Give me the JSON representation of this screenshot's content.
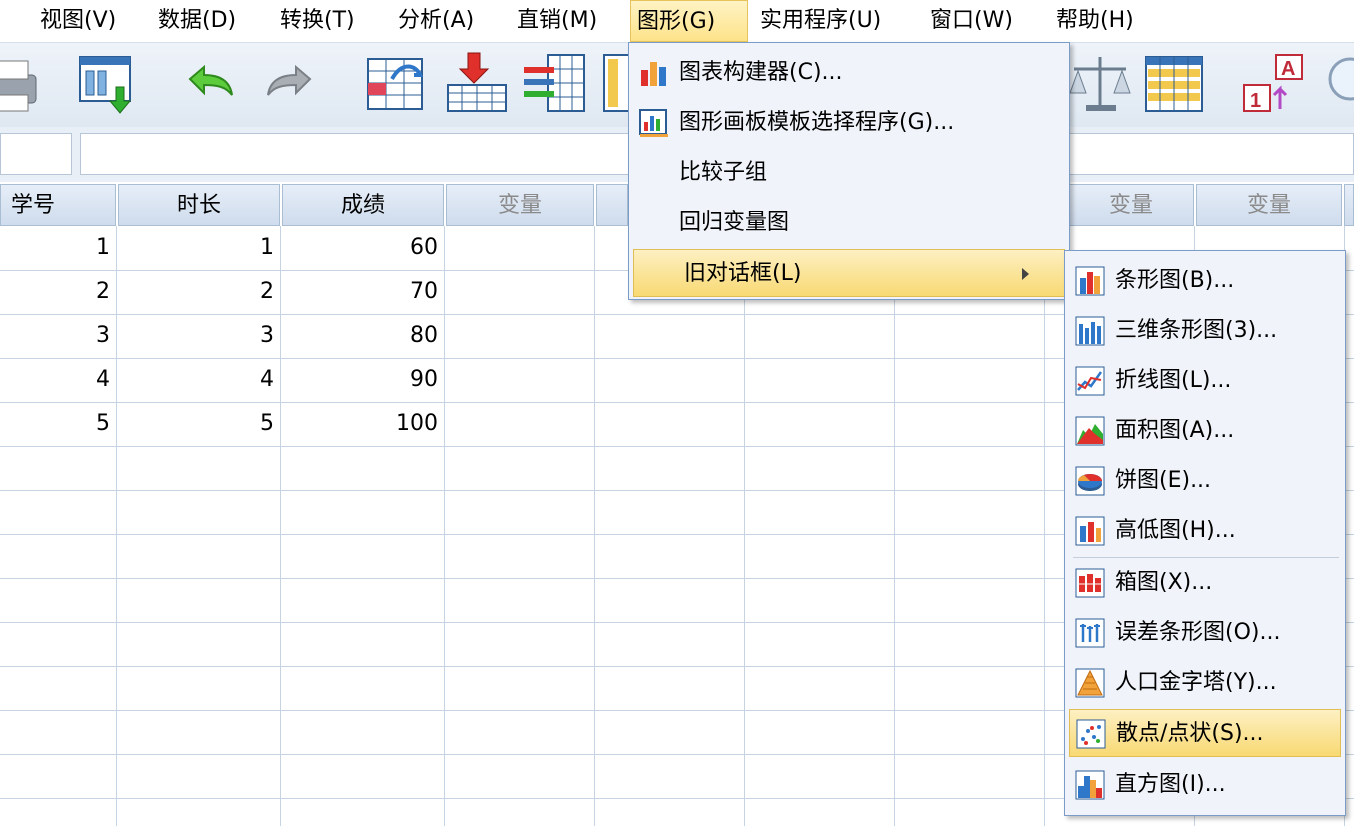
{
  "menubar": {
    "items": [
      {
        "label": "视图(V)"
      },
      {
        "label": "数据(D)"
      },
      {
        "label": "转换(T)"
      },
      {
        "label": "分析(A)"
      },
      {
        "label": "直销(M)"
      },
      {
        "label": "图形(G)"
      },
      {
        "label": "实用程序(U)"
      },
      {
        "label": "窗口(W)"
      },
      {
        "label": "帮助(H)"
      }
    ],
    "active_index": 5
  },
  "toolbar": {
    "icons": [
      "print-icon",
      "recall-dialog-icon",
      "undo-icon",
      "redo-icon",
      "goto-case-icon",
      "insert-cases-icon",
      "insert-variable-icon",
      "split-file-icon",
      "weight-cases-icon",
      "select-cases-icon",
      "value-labels-icon",
      "find-icon"
    ]
  },
  "grid": {
    "headers": [
      "学号",
      "时长",
      "成绩",
      "变量",
      "变量",
      "变量"
    ],
    "rows": [
      [
        "1",
        "1",
        "60"
      ],
      [
        "2",
        "2",
        "70"
      ],
      [
        "3",
        "3",
        "80"
      ],
      [
        "4",
        "4",
        "90"
      ],
      [
        "5",
        "5",
        "100"
      ]
    ]
  },
  "graphs_menu": {
    "items": [
      {
        "label": "图表构建器(C)...",
        "icon": "chart-builder-icon"
      },
      {
        "label": "图形画板模板选择程序(G)...",
        "icon": "graphboard-icon"
      },
      {
        "label": "比较子组",
        "icon": ""
      },
      {
        "label": "回归变量图",
        "icon": ""
      },
      {
        "label": "旧对话框(L)",
        "icon": "",
        "submenu": true
      }
    ],
    "highlight_index": 4
  },
  "legacy_menu": {
    "items": [
      {
        "label": "条形图(B)...",
        "icon": "bar-chart-icon"
      },
      {
        "label": "三维条形图(3)...",
        "icon": "3d-bar-chart-icon"
      },
      {
        "label": "折线图(L)...",
        "icon": "line-chart-icon"
      },
      {
        "label": "面积图(A)...",
        "icon": "area-chart-icon"
      },
      {
        "label": "饼图(E)...",
        "icon": "pie-chart-icon"
      },
      {
        "label": "高低图(H)...",
        "icon": "high-low-chart-icon"
      },
      {
        "label": "箱图(X)...",
        "icon": "boxplot-icon"
      },
      {
        "label": "误差条形图(O)...",
        "icon": "error-bar-icon"
      },
      {
        "label": "人口金字塔(Y)...",
        "icon": "pyramid-icon"
      },
      {
        "label": "散点/点状(S)...",
        "icon": "scatter-icon"
      },
      {
        "label": "直方图(I)...",
        "icon": "histogram-icon"
      }
    ],
    "highlight_index": 9
  },
  "colors": {
    "menu_highlight": "#fde38a",
    "grid_line": "#c5d3e2",
    "header_bg": "#dbe6f3"
  }
}
